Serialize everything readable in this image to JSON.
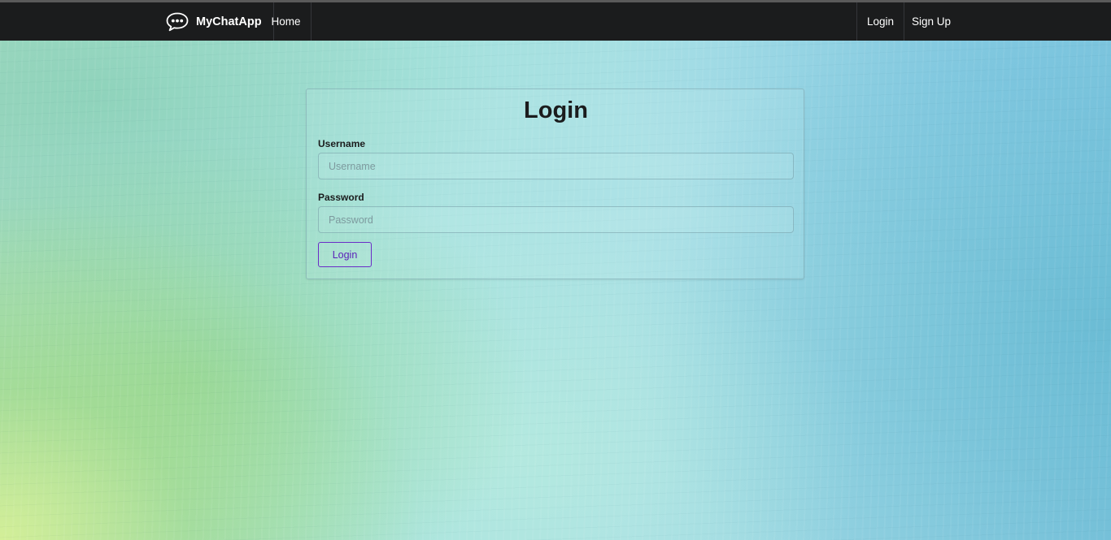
{
  "navbar": {
    "brand_icon": "chat-bubble-icon",
    "brand_name": "MyChatApp",
    "home_label": "Home",
    "login_label": "Login",
    "signup_label": "Sign Up",
    "background_color": "#1b1c1d"
  },
  "form": {
    "title": "Login",
    "username_label": "Username",
    "username_placeholder": "Username",
    "username_value": "",
    "password_label": "Password",
    "password_placeholder": "Password",
    "password_value": "",
    "submit_label": "Login",
    "submit_color": "#6a2cc7"
  }
}
